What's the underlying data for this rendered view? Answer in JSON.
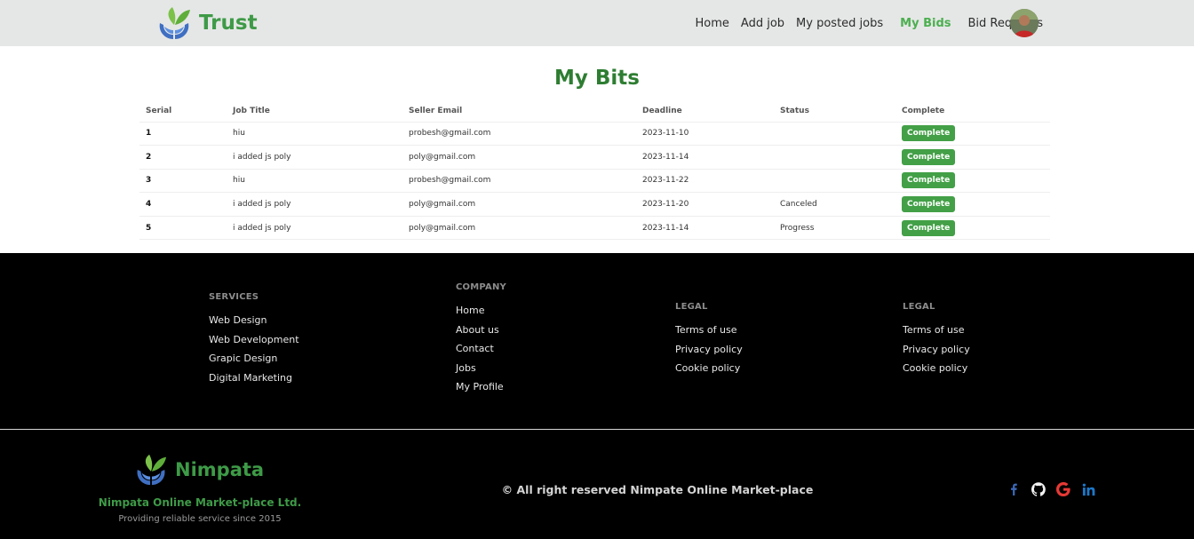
{
  "nav": {
    "brand": "Trust",
    "links": [
      "Home",
      "Add job",
      "My posted jobs",
      "My Bids",
      "Bid Requests"
    ],
    "active_link": "My Bids",
    "active_color": "#4caf50"
  },
  "main": {
    "title": "My Bits",
    "table": {
      "headers": [
        "Serial",
        "Job Title",
        "Seller Email",
        "Deadline",
        "Status",
        "Complete"
      ],
      "rows": [
        {
          "serial": "1",
          "job_title": "hiu",
          "seller_email": "probesh@gmail.com",
          "deadline": "2023-11-10",
          "status": "",
          "action": "Complete"
        },
        {
          "serial": "2",
          "job_title": "i added js poly",
          "seller_email": "poly@gmail.com",
          "deadline": "2023-11-14",
          "status": "",
          "action": "Complete"
        },
        {
          "serial": "3",
          "job_title": "hiu",
          "seller_email": "probesh@gmail.com",
          "deadline": "2023-11-22",
          "status": "",
          "action": "Complete"
        },
        {
          "serial": "4",
          "job_title": "i added js poly",
          "seller_email": "poly@gmail.com",
          "deadline": "2023-11-20",
          "status": "Canceled",
          "action": "Complete"
        },
        {
          "serial": "5",
          "job_title": "i added js poly",
          "seller_email": "poly@gmail.com",
          "deadline": "2023-11-14",
          "status": "Progress",
          "action": "Complete"
        }
      ]
    }
  },
  "footer": {
    "services": {
      "heading": "SERVICES",
      "links": [
        "Web Design",
        "Web Development",
        "Grapic Design",
        "Digital Marketing"
      ]
    },
    "company": {
      "heading": "COMPANY",
      "links": [
        "Home",
        "About us",
        "Contact",
        "Jobs",
        "My Profile"
      ]
    },
    "legal1": {
      "heading": "LEGAL",
      "links": [
        "Terms of use",
        "Privacy policy",
        "Cookie policy"
      ]
    },
    "legal2": {
      "heading": "LEGAL",
      "links": [
        "Terms of use",
        "Privacy policy",
        "Cookie policy"
      ]
    },
    "brand": "Nimpata",
    "company_name": "Nimpata Online Market-place Ltd.",
    "tagline": "Providing reliable service since 2015",
    "copyright": "© All right reserved Nimpate Online Market-place",
    "socials": [
      "facebook-icon",
      "github-icon",
      "google-icon",
      "linkedin-icon"
    ]
  },
  "colors": {
    "brand_green": "#3e9a47",
    "title_green": "#2e7d32",
    "button_green": "#43a047"
  }
}
